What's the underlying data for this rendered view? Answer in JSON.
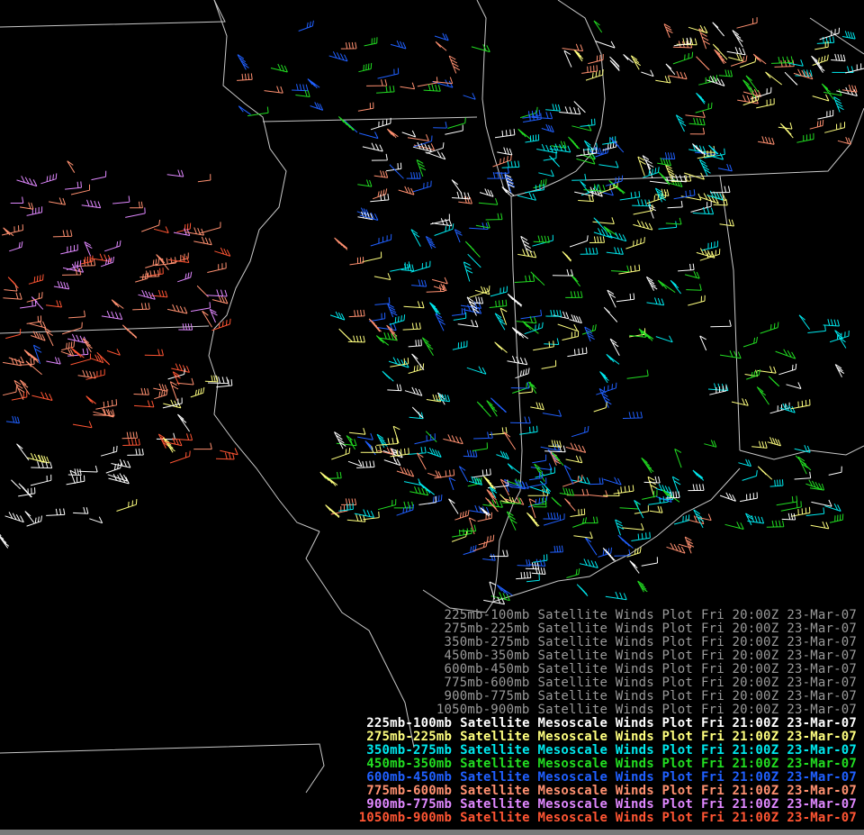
{
  "colors": {
    "background": "#000000",
    "boundary": "#c8c8c8",
    "strip": "#7a7a7a",
    "previous_text": "#9a9a9a"
  },
  "layers": [
    {
      "key": "l225_100",
      "color": "#ffffff",
      "label": "225mb-100mb"
    },
    {
      "key": "l275_225",
      "color": "#ffff7f",
      "label": "275mb-225mb"
    },
    {
      "key": "l350_275",
      "color": "#00e8ee",
      "label": "350mb-275mb"
    },
    {
      "key": "l450_350",
      "color": "#22dd22",
      "label": "450mb-350mb"
    },
    {
      "key": "l600_450",
      "color": "#2060ff",
      "label": "600mb-450mb"
    },
    {
      "key": "l775_600",
      "color": "#ff9070",
      "label": "775mb-600mb"
    },
    {
      "key": "l900_775",
      "color": "#e088ff",
      "label": "900mb-775mb"
    },
    {
      "key": "l1050_900",
      "color": "#ff5533",
      "label": "1050mb-900mb"
    }
  ],
  "legend": {
    "previous": [
      {
        "layer": "225mb-100mb",
        "product": "Satellite Winds Plot",
        "time": "Fri 20:00Z",
        "date": "23-Mar-07"
      },
      {
        "layer": "275mb-225mb",
        "product": "Satellite Winds Plot",
        "time": "Fri 20:00Z",
        "date": "23-Mar-07"
      },
      {
        "layer": "350mb-275mb",
        "product": "Satellite Winds Plot",
        "time": "Fri 20:00Z",
        "date": "23-Mar-07"
      },
      {
        "layer": "450mb-350mb",
        "product": "Satellite Winds Plot",
        "time": "Fri 20:00Z",
        "date": "23-Mar-07"
      },
      {
        "layer": "600mb-450mb",
        "product": "Satellite Winds Plot",
        "time": "Fri 20:00Z",
        "date": "23-Mar-07"
      },
      {
        "layer": "775mb-600mb",
        "product": "Satellite Winds Plot",
        "time": "Fri 20:00Z",
        "date": "23-Mar-07"
      },
      {
        "layer": "900mb-775mb",
        "product": "Satellite Winds Plot",
        "time": "Fri 20:00Z",
        "date": "23-Mar-07"
      },
      {
        "layer": "1050mb-900mb",
        "product": "Satellite Winds Plot",
        "time": "Fri 20:00Z",
        "date": "23-Mar-07"
      }
    ],
    "current": [
      {
        "layer": "225mb-100mb",
        "product": "Satellite Mesoscale Winds Plot",
        "time": "Fri 21:00Z",
        "date": "23-Mar-07",
        "color": "#ffffff"
      },
      {
        "layer": "275mb-225mb",
        "product": "Satellite Mesoscale Winds Plot",
        "time": "Fri 21:00Z",
        "date": "23-Mar-07",
        "color": "#ffff7f"
      },
      {
        "layer": "350mb-275mb",
        "product": "Satellite Mesoscale Winds Plot",
        "time": "Fri 21:00Z",
        "date": "23-Mar-07",
        "color": "#00e8ee"
      },
      {
        "layer": "450mb-350mb",
        "product": "Satellite Mesoscale Winds Plot",
        "time": "Fri 21:00Z",
        "date": "23-Mar-07",
        "color": "#22dd22"
      },
      {
        "layer": "600mb-450mb",
        "product": "Satellite Mesoscale Winds Plot",
        "time": "Fri 21:00Z",
        "date": "23-Mar-07",
        "color": "#2060ff"
      },
      {
        "layer": "775mb-600mb",
        "product": "Satellite Mesoscale Winds Plot",
        "time": "Fri 21:00Z",
        "date": "23-Mar-07",
        "color": "#ff9070"
      },
      {
        "layer": "900mb-775mb",
        "product": "Satellite Mesoscale Winds Plot",
        "time": "Fri 21:00Z",
        "date": "23-Mar-07",
        "color": "#e088ff"
      },
      {
        "layer": "1050mb-900mb",
        "product": "Satellite Mesoscale Winds Plot",
        "time": "Fri 21:00Z",
        "date": "23-Mar-07",
        "color": "#ff5533"
      }
    ]
  }
}
